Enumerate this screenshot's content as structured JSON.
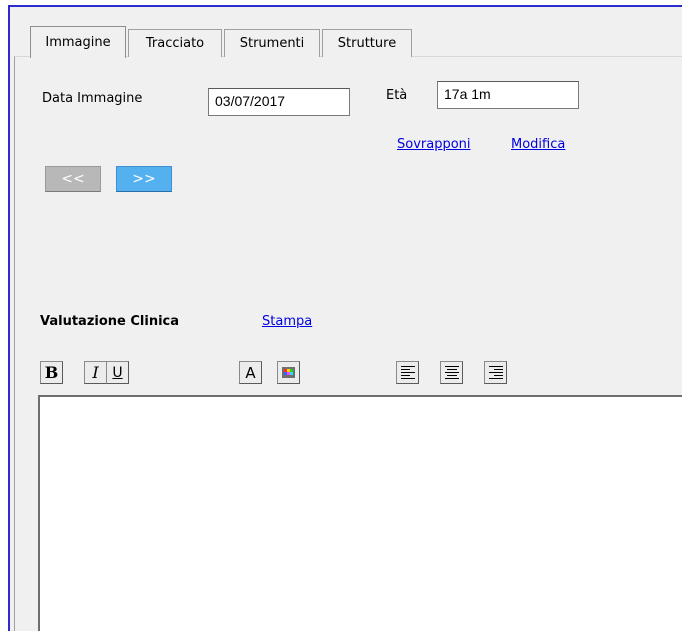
{
  "tabs": [
    {
      "label": "Immagine",
      "active": true
    },
    {
      "label": "Tracciato",
      "active": false
    },
    {
      "label": "Strumenti",
      "active": false
    },
    {
      "label": "Strutture",
      "active": false
    }
  ],
  "image_date": {
    "label": "Data Immagine",
    "value": "03/07/2017"
  },
  "age": {
    "label": "Età",
    "value": "17a 1m"
  },
  "links": {
    "overlay": "Sovrapponi",
    "edit": "Modifica",
    "print": "Stampa"
  },
  "nav": {
    "prev": "<<",
    "next": ">>"
  },
  "clinical": {
    "title": "Valutazione Clinica",
    "text": ""
  },
  "format": {
    "bold": "B",
    "italic": "I",
    "underline": "U",
    "font_color": "A"
  },
  "colors": {
    "frame": "#2b2bcf",
    "link": "#0000e0",
    "next_button": "#55b0f0",
    "prev_button": "#b8b8b8"
  }
}
